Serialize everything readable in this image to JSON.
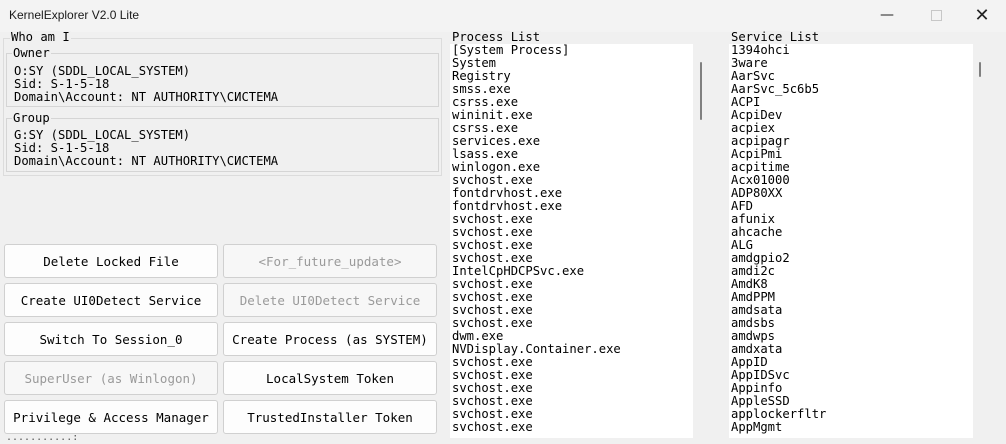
{
  "window": {
    "title": "KernelExplorer V2.0 Lite",
    "minimize_icon": "minimize-icon",
    "maximize_icon": "maximize-icon",
    "close_icon": "close-icon"
  },
  "whoami": {
    "title": "Who am I",
    "owner": {
      "label": "Owner",
      "lines": [
        "O:SY (SDDL_LOCAL_SYSTEM)",
        "Sid: S-1-5-18",
        "Domain\\Account: NT AUTHORITY\\СИСТЕМА"
      ]
    },
    "group": {
      "label": "Group",
      "lines": [
        "G:SY (SDDL_LOCAL_SYSTEM)",
        "Sid: S-1-5-18",
        "Domain\\Account: NT AUTHORITY\\СИСТЕМА"
      ]
    }
  },
  "buttons": [
    {
      "label": "Delete Locked File",
      "enabled": true
    },
    {
      "label": "<For_future_update>",
      "enabled": false
    },
    {
      "label": "Create UI0Detect Service",
      "enabled": true
    },
    {
      "label": "Delete UI0Detect Service",
      "enabled": false
    },
    {
      "label": "Switch To Session_0",
      "enabled": true
    },
    {
      "label": "Create Process (as SYSTEM)",
      "enabled": true
    },
    {
      "label": "SuperUser (as Winlogon)",
      "enabled": false
    },
    {
      "label": "LocalSystem Token",
      "enabled": true
    },
    {
      "label": "Privilege & Access Manager",
      "enabled": true
    },
    {
      "label": "TrustedInstaller Token",
      "enabled": true
    }
  ],
  "process_list": {
    "title": "Process List",
    "items": [
      "[System Process]",
      "System",
      "Registry",
      "smss.exe",
      "csrss.exe",
      "wininit.exe",
      "csrss.exe",
      "services.exe",
      "lsass.exe",
      "winlogon.exe",
      "svchost.exe",
      "fontdrvhost.exe",
      "fontdrvhost.exe",
      "svchost.exe",
      "svchost.exe",
      "svchost.exe",
      "svchost.exe",
      "IntelCpHDCPSvc.exe",
      "svchost.exe",
      "svchost.exe",
      "svchost.exe",
      "svchost.exe",
      "dwm.exe",
      "NVDisplay.Container.exe",
      "svchost.exe",
      "svchost.exe",
      "svchost.exe",
      "svchost.exe",
      "svchost.exe",
      "svchost.exe"
    ]
  },
  "service_list": {
    "title": "Service List",
    "items": [
      "1394ohci",
      "3ware",
      "AarSvc",
      "AarSvc_5c6b5",
      "ACPI",
      "AcpiDev",
      "acpiex",
      "acpipagr",
      "AcpiPmi",
      "acpitime",
      "Acx01000",
      "ADP80XX",
      "AFD",
      "afunix",
      "ahcache",
      "ALG",
      "amdgpio2",
      "amdi2c",
      "AmdK8",
      "AmdPPM",
      "amdsata",
      "amdsbs",
      "amdwps",
      "amdxata",
      "AppID",
      "AppIDSvc",
      "Appinfo",
      "AppleSSD",
      "applockerfltr",
      "AppMgmt"
    ]
  },
  "footer": {
    "text": "...........:"
  }
}
